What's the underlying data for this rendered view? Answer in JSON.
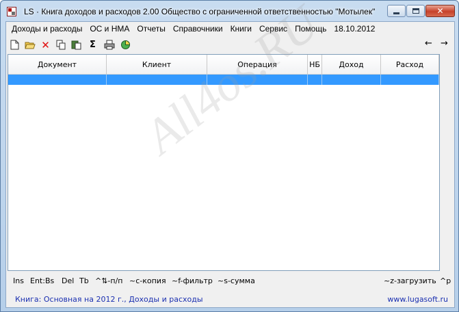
{
  "window": {
    "title": "LS · Книга доходов и расходов 2.00    Общество с ограниченной ответственностью \"Мотылек\""
  },
  "menu": {
    "items": [
      "Доходы и расходы",
      "ОС и НМА",
      "Отчеты",
      "Справочники",
      "Книги",
      "Сервис",
      "Помощь"
    ],
    "date": "18.10.2012"
  },
  "toolbar": {
    "icons": [
      "new-document-icon",
      "open-folder-icon",
      "delete-icon",
      "copy-icon",
      "paste-icon",
      "sum-icon",
      "print-icon",
      "chart-icon"
    ],
    "sum_glyph": "Σ",
    "nav_left": "←",
    "nav_right": "→"
  },
  "grid": {
    "columns": [
      "Документ",
      "Клиент",
      "Операция",
      "НБ",
      "Доход",
      "Расход"
    ]
  },
  "hotkeys": {
    "ins": "Ins",
    "ent": "Ent:Bs",
    "del": "Del",
    "tb": "Tb",
    "order": "^⇅-п/п",
    "copy": "~c-копия",
    "filter": "~f-фильтр",
    "sum": "~s-сумма",
    "load": "~z-загрузить",
    "p": "^p"
  },
  "status": {
    "book": "Книга: Основная на 2012 г., Доходы и расходы",
    "site": "www.lugasoft.ru"
  },
  "watermark": "All4os.RU",
  "colors": {
    "selection": "#3399ff",
    "status_text": "#1a2fb0"
  }
}
